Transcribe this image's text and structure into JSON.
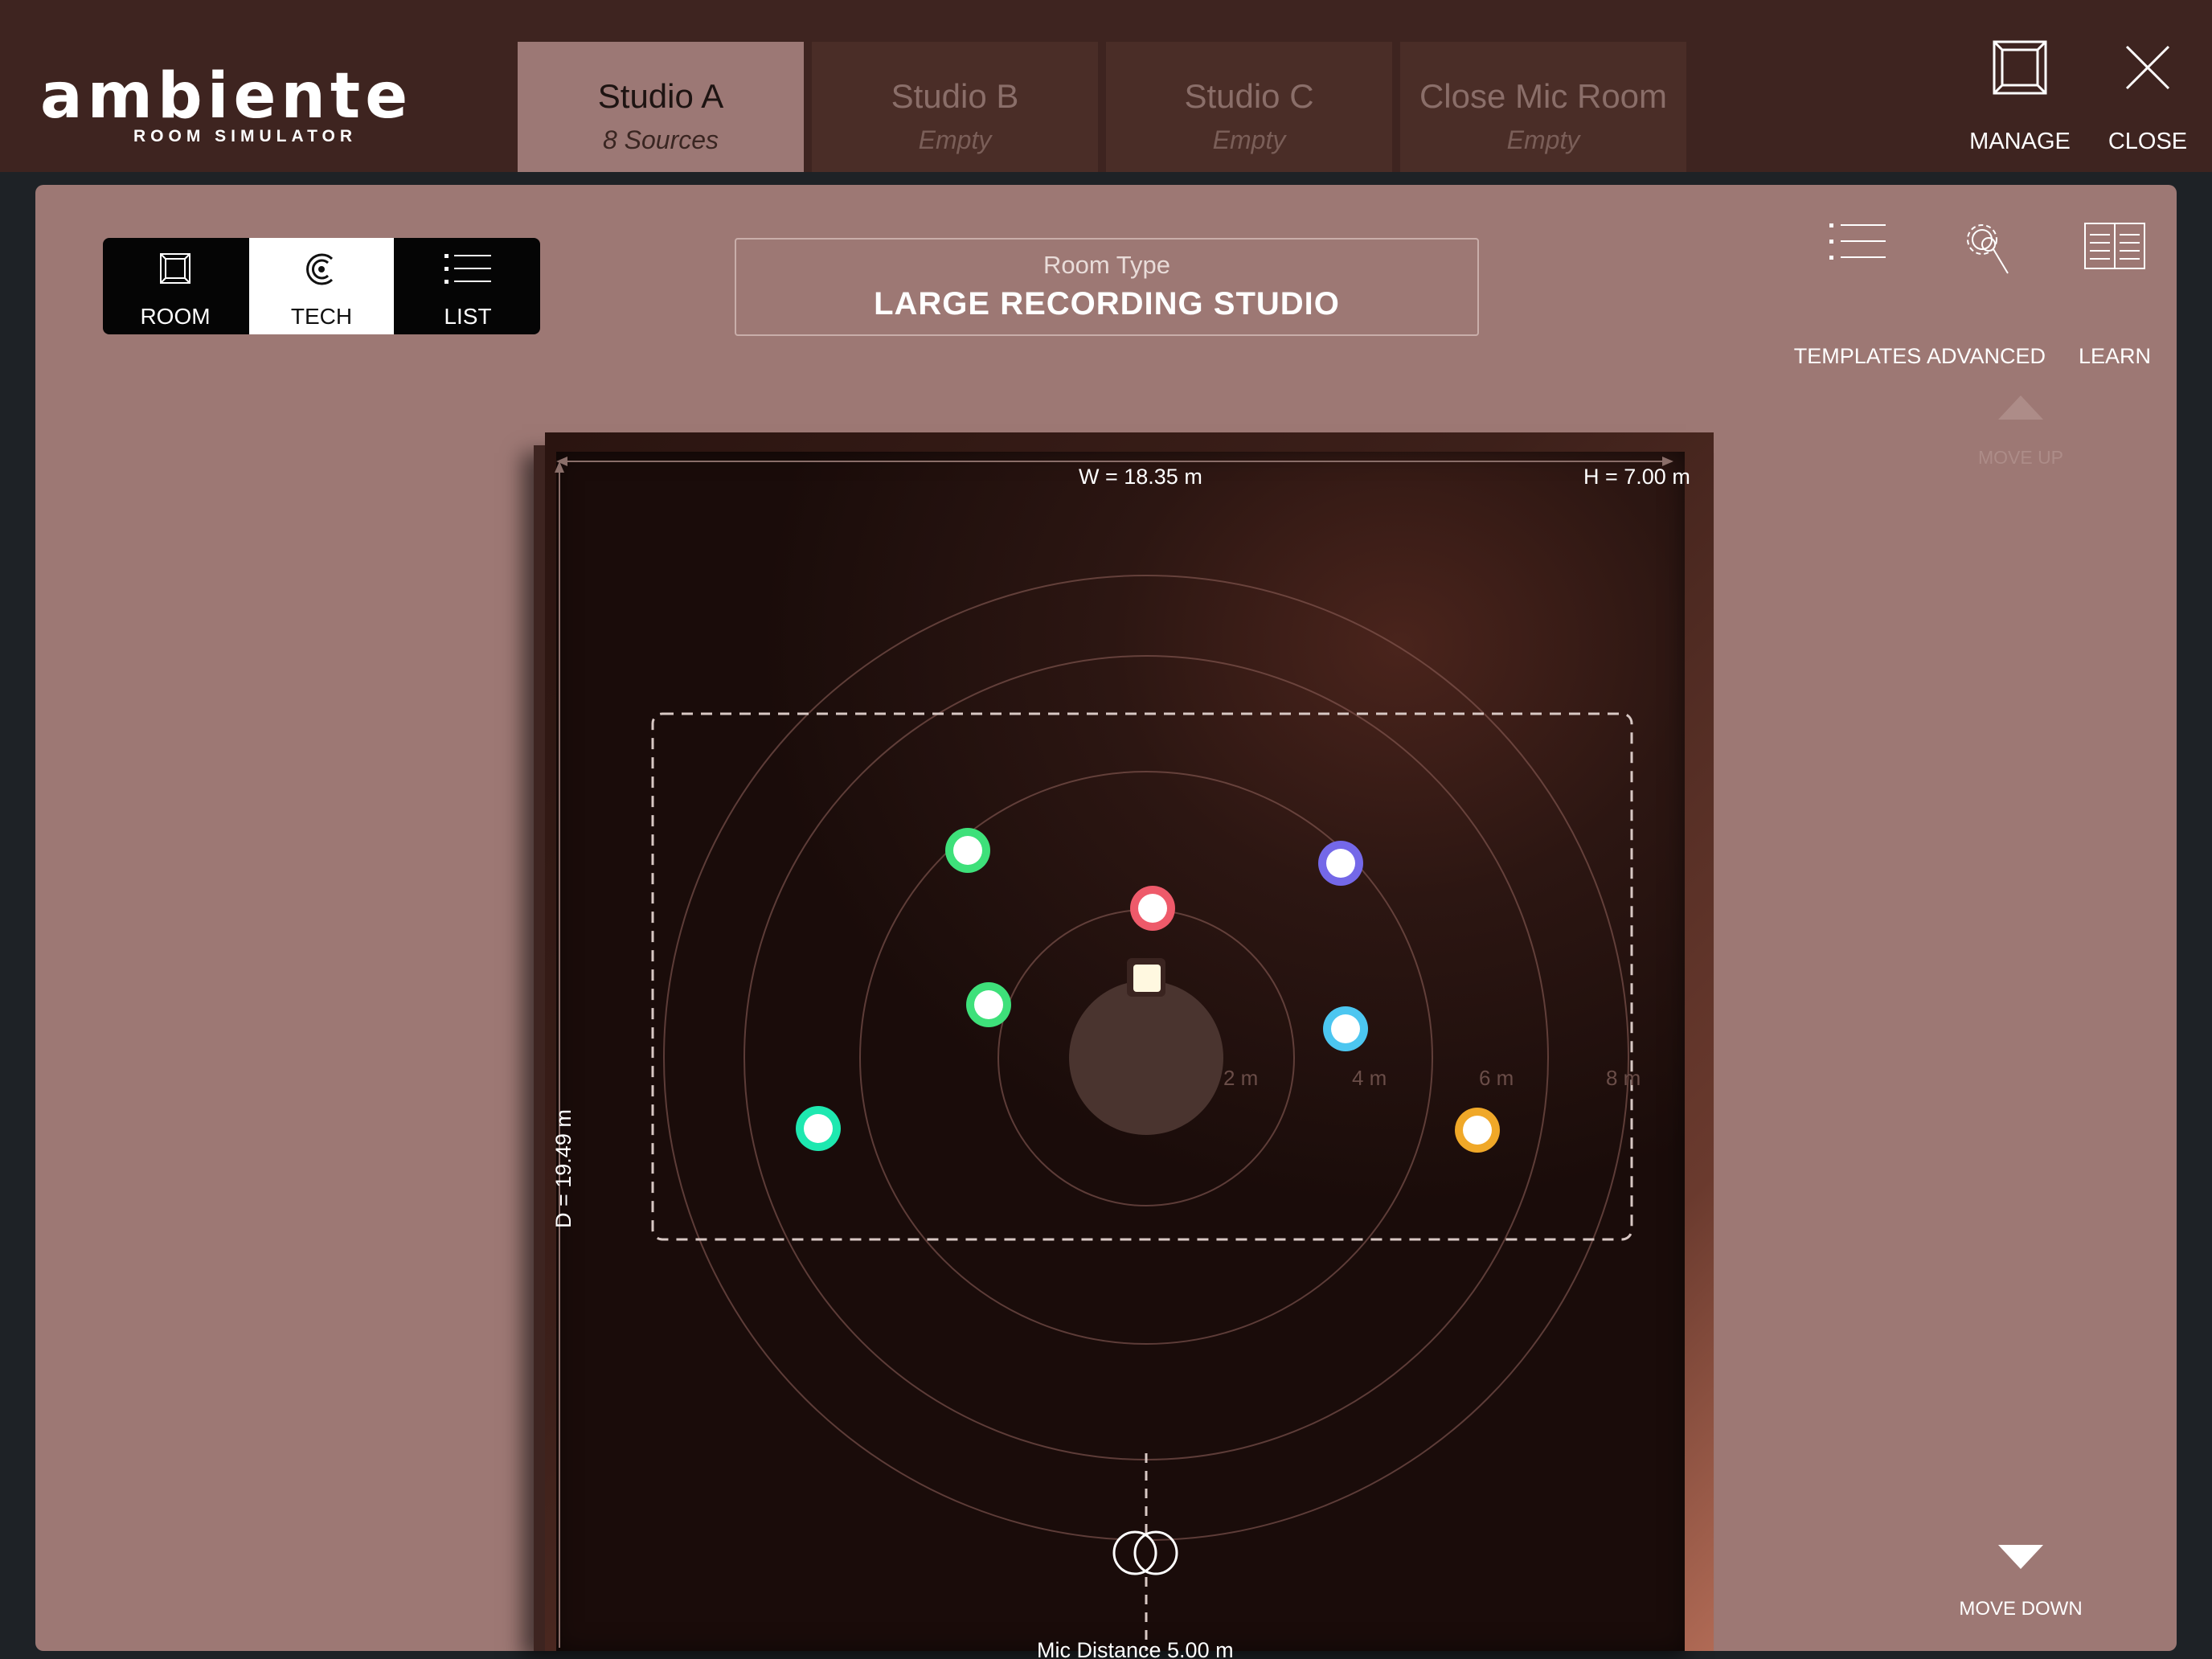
{
  "app": {
    "logo_text": "ambiente",
    "logo_subtitle": "ROOM SIMULATOR"
  },
  "tabs": [
    {
      "name": "Studio A",
      "sub": "8 Sources",
      "active": true
    },
    {
      "name": "Studio B",
      "sub": "Empty",
      "active": false
    },
    {
      "name": "Studio C",
      "sub": "Empty",
      "active": false
    },
    {
      "name": "Close Mic Room",
      "sub": "Empty",
      "active": false
    }
  ],
  "top_actions": {
    "manage": "MANAGE",
    "close": "CLOSE"
  },
  "view_mode": {
    "room": "ROOM",
    "tech": "TECH",
    "list": "LIST",
    "selected": "TECH"
  },
  "room_type": {
    "label": "Room Type",
    "value": "LARGE RECORDING STUDIO"
  },
  "right_actions": {
    "templates": "TEMPLATES",
    "advanced": "ADVANCED",
    "learn": "LEARN",
    "move_up": "MOVE UP",
    "move_down": "MOVE DOWN"
  },
  "room": {
    "width": "W = 18.35 m",
    "height": "H = 7.00 m",
    "depth": "D = 19.49 m",
    "mic_distance": "Mic Distance 5.00 m",
    "ring_labels": [
      "2 m",
      "4 m",
      "6 m",
      "8 m"
    ]
  },
  "sources": [
    {
      "color": "#3ee07a"
    },
    {
      "color": "#7468e8"
    },
    {
      "color": "#ee5a6a"
    },
    {
      "color": "#3ee07a"
    },
    {
      "color": "#4cc6f0"
    },
    {
      "color": "#1ee8b0"
    },
    {
      "color": "#f0a828"
    }
  ]
}
